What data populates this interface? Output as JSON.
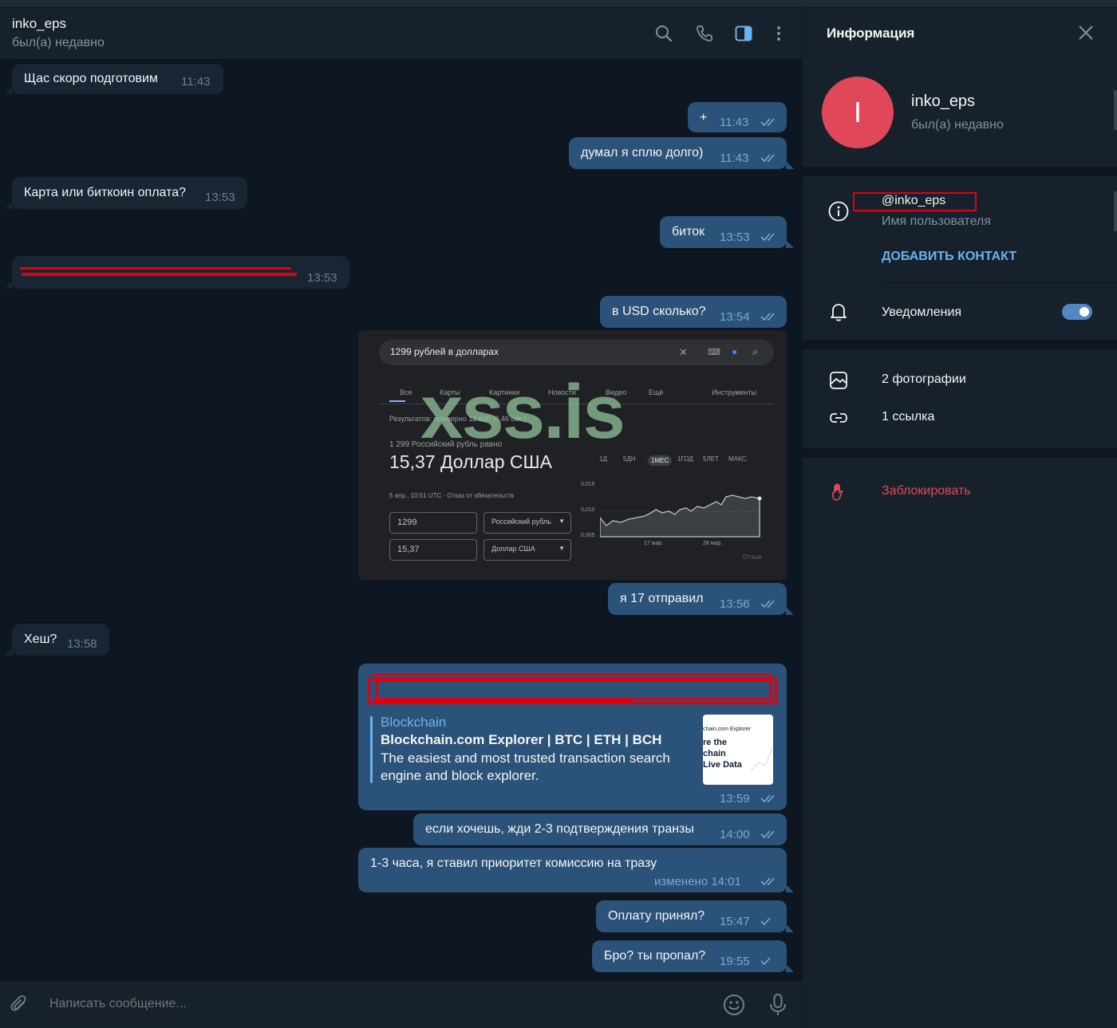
{
  "chat": {
    "peer_name": "inko_eps",
    "peer_status": "был(а) недавно",
    "composer_placeholder": "Написать сообщение...",
    "messages": [
      {
        "text": "Щас скоро подготовим",
        "time": "11:43"
      },
      {
        "text": "+",
        "time": "11:43"
      },
      {
        "text": "думал я сплю долго)",
        "time": "11:43"
      },
      {
        "text": "Карта или биткоин оплата?",
        "time": "13:53"
      },
      {
        "text": "биток",
        "time": "13:53"
      },
      {
        "text": "",
        "time": "13:53"
      },
      {
        "text": "в USD сколько?",
        "time": "13:54"
      },
      {
        "text": "я 17 отправил",
        "time": "13:56"
      },
      {
        "text": "Хеш?",
        "time": "13:58"
      },
      {
        "text": "",
        "time": "13:59"
      },
      {
        "text": "если хочешь, жди 2-3 подтверждения транзы",
        "time": "14:00"
      },
      {
        "text": "1-3 часа, я ставил приоритет комиссию на тразу",
        "time": "изменено 14:01"
      },
      {
        "text": "Оплату принял?",
        "time": "15:47"
      },
      {
        "text": "Бро? ты пропал?",
        "time": "19:55"
      }
    ],
    "screenshot": {
      "query": "1299 рублей в долларах",
      "tabs": [
        "Все",
        "Карты",
        "Картинки",
        "Новости",
        "Видео",
        "Ещё"
      ],
      "tools": "Инструменты",
      "results": "Результатов: примерно 12 600 (0,46 сек.)",
      "equals": "1 299 Российский рубль равно",
      "result": "15,37 Доллар США",
      "date": "5 апр., 10:51 UTC · Отказ от обязательств",
      "amount_from": "1299",
      "currency_from": "Российский рубль",
      "amount_to": "15,37",
      "currency_to": "Доллар США",
      "ranges": [
        "1Д",
        "5ДН",
        "1МЕС",
        "1ГОД",
        "5ЛЕТ",
        "МАКС."
      ],
      "y_ticks": [
        "0,015",
        "0,010",
        "0,005"
      ],
      "x_ticks": [
        "17 мар.",
        "28 мар."
      ],
      "feedback": "Отзыв",
      "watermark": "xss.is"
    },
    "link_preview": {
      "site": "Blockchain",
      "title": "Blockchain.com Explorer | BTC | ETH | BCH",
      "description": "The easiest and most trusted transaction search engine and block explorer.",
      "thumb_top": "chain.com Explorer",
      "thumb_text": "re the\nchain\nLive Data"
    }
  },
  "panel": {
    "title": "Информация",
    "name": "inko_eps",
    "status": "был(а) недавно",
    "avatar_letter": "I",
    "username": "@inko_eps",
    "username_label": "Имя пользователя",
    "add_contact": "ДОБАВИТЬ КОНТАКТ",
    "notifications": "Уведомления",
    "notifications_on": true,
    "photos": "2 фотографии",
    "links": "1 ссылка",
    "block": "Заблокировать"
  },
  "colors": {
    "bg": "#0e1621",
    "header": "#17212b",
    "bubble_in": "#182533",
    "bubble_out": "#2b5278",
    "accent": "#6ab3f3",
    "avatar": "#e0485a",
    "danger": "#e0485a"
  }
}
